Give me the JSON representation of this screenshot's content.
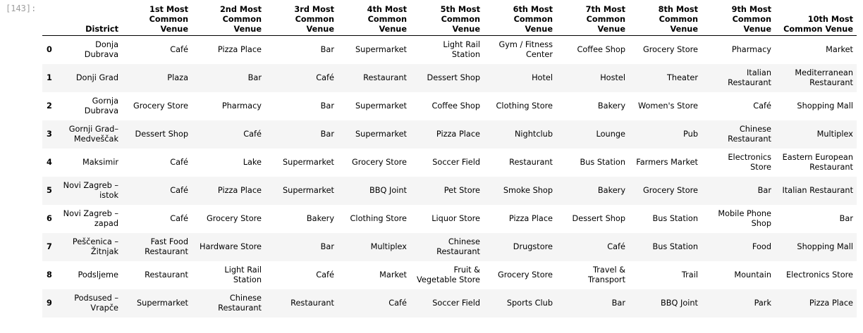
{
  "cell": {
    "prompt": "[143]:"
  },
  "table": {
    "index_header": "",
    "columns": [
      "District",
      "1st Most Common Venue",
      "2nd Most Common Venue",
      "3rd Most Common Venue",
      "4th Most Common Venue",
      "5th Most Common Venue",
      "6th Most Common Venue",
      "7th Most Common Venue",
      "8th Most Common Venue",
      "9th Most Common Venue",
      "10th Most Common Venue"
    ],
    "rows": [
      {
        "index": "0",
        "cells": [
          "Donja Dubrava",
          "Café",
          "Pizza Place",
          "Bar",
          "Supermarket",
          "Light Rail Station",
          "Gym / Fitness Center",
          "Coffee Shop",
          "Grocery Store",
          "Pharmacy",
          "Market"
        ]
      },
      {
        "index": "1",
        "cells": [
          "Donji Grad",
          "Plaza",
          "Bar",
          "Café",
          "Restaurant",
          "Dessert Shop",
          "Hotel",
          "Hostel",
          "Theater",
          "Italian Restaurant",
          "Mediterranean Restaurant"
        ]
      },
      {
        "index": "2",
        "cells": [
          "Gornja Dubrava",
          "Grocery Store",
          "Pharmacy",
          "Bar",
          "Supermarket",
          "Coffee Shop",
          "Clothing Store",
          "Bakery",
          "Women's Store",
          "Café",
          "Shopping Mall"
        ]
      },
      {
        "index": "3",
        "cells": [
          "Gornji Grad–Medveščak",
          "Dessert Shop",
          "Café",
          "Bar",
          "Supermarket",
          "Pizza Place",
          "Nightclub",
          "Lounge",
          "Pub",
          "Chinese Restaurant",
          "Multiplex"
        ]
      },
      {
        "index": "4",
        "cells": [
          "Maksimir",
          "Café",
          "Lake",
          "Supermarket",
          "Grocery Store",
          "Soccer Field",
          "Restaurant",
          "Bus Station",
          "Farmers Market",
          "Electronics Store",
          "Eastern European Restaurant"
        ]
      },
      {
        "index": "5",
        "cells": [
          "Novi Zagreb – istok",
          "Café",
          "Pizza Place",
          "Supermarket",
          "BBQ Joint",
          "Pet Store",
          "Smoke Shop",
          "Bakery",
          "Grocery Store",
          "Bar",
          "Italian Restaurant"
        ]
      },
      {
        "index": "6",
        "cells": [
          "Novi Zagreb – zapad",
          "Café",
          "Grocery Store",
          "Bakery",
          "Clothing Store",
          "Liquor Store",
          "Pizza Place",
          "Dessert Shop",
          "Bus Station",
          "Mobile Phone Shop",
          "Bar"
        ]
      },
      {
        "index": "7",
        "cells": [
          "Peščenica – Žitnjak",
          "Fast Food Restaurant",
          "Hardware Store",
          "Bar",
          "Multiplex",
          "Chinese Restaurant",
          "Drugstore",
          "Café",
          "Bus Station",
          "Food",
          "Shopping Mall"
        ]
      },
      {
        "index": "8",
        "cells": [
          "Podsljeme",
          "Restaurant",
          "Light Rail Station",
          "Café",
          "Market",
          "Fruit & Vegetable Store",
          "Grocery Store",
          "Travel & Transport",
          "Trail",
          "Mountain",
          "Electronics Store"
        ]
      },
      {
        "index": "9",
        "cells": [
          "Podsused – Vrapče",
          "Supermarket",
          "Chinese Restaurant",
          "Restaurant",
          "Café",
          "Soccer Field",
          "Sports Club",
          "Bar",
          "BBQ Joint",
          "Park",
          "Pizza Place"
        ]
      }
    ]
  }
}
